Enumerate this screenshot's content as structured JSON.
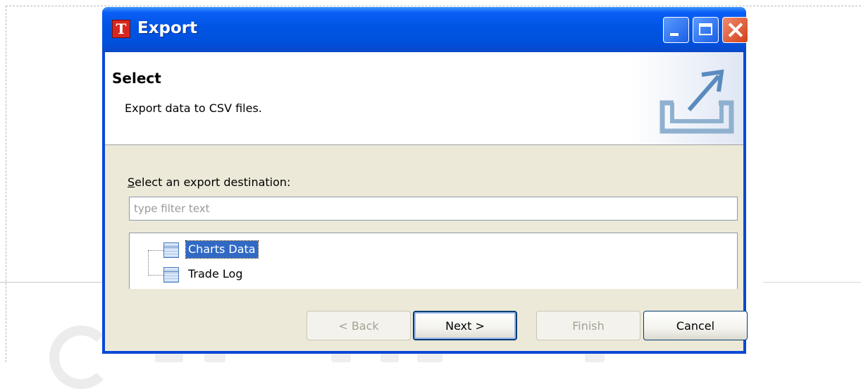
{
  "window": {
    "title": "Export",
    "app_icon_glyph": "T",
    "controls": {
      "minimize": "minimize-icon",
      "maximize": "maximize-icon",
      "close": "close-icon"
    }
  },
  "banner": {
    "title": "Select",
    "description": "Export data to CSV files.",
    "icon": "export-arrow-icon"
  },
  "destination": {
    "label_prefix": "S",
    "label_rest": "elect an export destination:",
    "filter_placeholder": "type filter text",
    "filter_value": ""
  },
  "tree": {
    "items": [
      {
        "label": "Charts Data",
        "icon": "table-icon",
        "selected": true
      },
      {
        "label": "Trade Log",
        "icon": "table-icon",
        "selected": false
      }
    ]
  },
  "buttons": {
    "back": "< Back",
    "next": "Next >",
    "finish": "Finish",
    "cancel": "Cancel"
  },
  "colors": {
    "titlebar": "#0054e3",
    "client": "#ece9d8",
    "selection": "#316ac5"
  }
}
